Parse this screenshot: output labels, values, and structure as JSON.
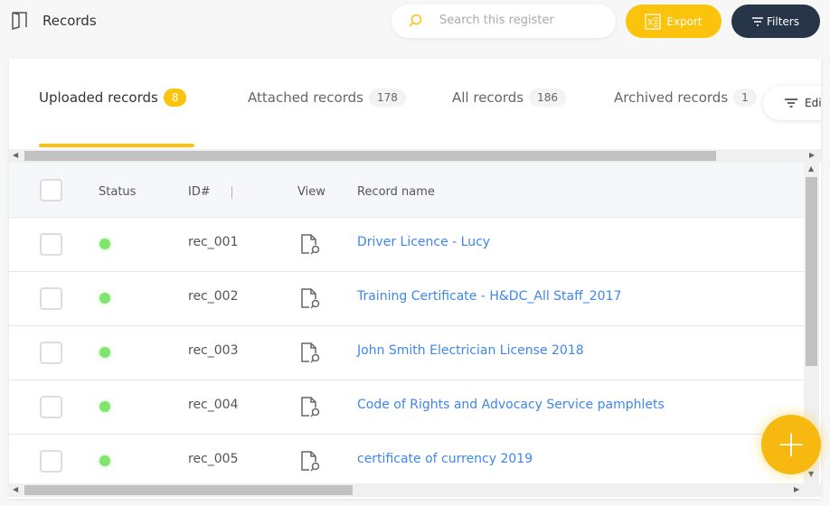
{
  "header": {
    "title": "Records",
    "search_placeholder": "Search this register",
    "export_label": "Export",
    "filters_label": "Filters"
  },
  "tabs": [
    {
      "label": "Uploaded records",
      "count": "8",
      "active": true
    },
    {
      "label": "Attached records",
      "count": "178"
    },
    {
      "label": "All records",
      "count": "186"
    },
    {
      "label": "Archived records",
      "count": "1"
    }
  ],
  "edit_label": "Edi",
  "table": {
    "columns": [
      "Status",
      "ID#",
      "View",
      "Record name"
    ],
    "rows": [
      {
        "status": "active",
        "id": "rec_001",
        "name": "Driver Licence - Lucy"
      },
      {
        "status": "active",
        "id": "rec_002",
        "name": "Training Certificate - H&DC_All Staff_2017"
      },
      {
        "status": "active",
        "id": "rec_003",
        "name": "John Smith Electrician License 2018"
      },
      {
        "status": "active",
        "id": "rec_004",
        "name": "Code of Rights and Advocacy Service pamphlets"
      },
      {
        "status": "active",
        "id": "rec_005",
        "name": "certificate of currency 2019"
      }
    ]
  },
  "fab_label": "+",
  "colors": {
    "accent": "#fbc30c",
    "dark": "#273548",
    "link": "#3e87ea",
    "status_active": "#7ee66b"
  }
}
